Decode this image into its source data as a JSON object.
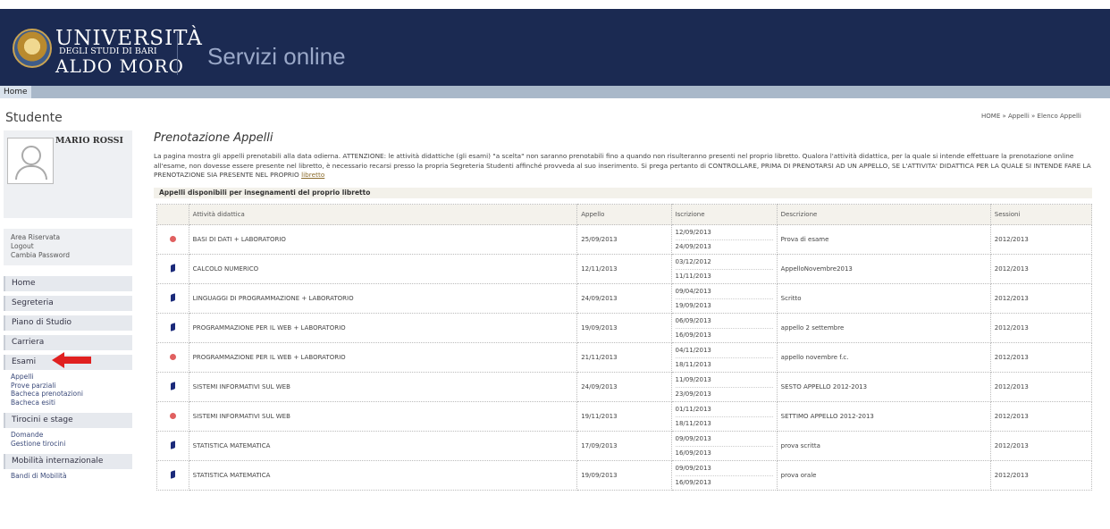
{
  "header": {
    "uni_line1": "UNIVERSITÀ",
    "uni_line2": "DEGLI STUDI DI BARI",
    "uni_line3": "ALDO MORO",
    "service_title": "Servizi online"
  },
  "menubar": {
    "home": "Home"
  },
  "sidebar": {
    "title": "Studente",
    "profile_name": "MARIO ROSSI",
    "area_links": [
      "Area Riservata",
      "Logout",
      "Cambia Password"
    ],
    "nav": [
      {
        "label": "Home",
        "sub": []
      },
      {
        "label": "Segreteria",
        "sub": []
      },
      {
        "label": "Piano di Studio",
        "sub": []
      },
      {
        "label": "Carriera",
        "sub": []
      },
      {
        "label": "Esami",
        "sub": [
          "Appelli",
          "Prove parziali",
          "Bacheca prenotazioni",
          "Bacheca esiti"
        ]
      },
      {
        "label": "Tirocini e stage",
        "sub": [
          "Domande",
          "Gestione tirocini"
        ]
      },
      {
        "label": "Mobilità internazionale",
        "sub": [
          "Bandi di Mobilità"
        ]
      }
    ]
  },
  "breadcrumb": "HOME » Appelli » Elenco Appelli",
  "main": {
    "title": "Prenotazione Appelli",
    "intro_text": "La pagina mostra gli appelli prenotabili alla data odierna. ATTENZIONE: le attività didattiche (gli esami) \"a scelta\" non saranno prenotabili fino a quando non risulteranno presenti nel proprio libretto. Qualora l'attività didattica, per la quale si intende effettuare la prenotazione online all'esame, non dovesse essere presente nel libretto, è necessario recarsi presso la propria Segreteria Studenti affinché provveda al suo inserimento. Si prega pertanto di CONTROLLARE, PRIMA DI PRENOTARSI AD UN APPELLO, SE L'ATTIVITA' DIDATTICA PER LA QUALE SI INTENDE FARE LA PRENOTAZIONE SIA PRESENTE NEL PROPRIO",
    "intro_link": "libretto",
    "table_caption": "Appelli disponibili per insegnamenti del proprio libretto",
    "columns": [
      "",
      "Attività didattica",
      "Appello",
      "Iscrizione",
      "Descrizione",
      "Sessioni"
    ],
    "rows": [
      {
        "status": "closed",
        "activity": "BASI DI DATI + LABORATORIO",
        "appello": "25/09/2013",
        "iscr_from": "12/09/2013",
        "iscr_to": "24/09/2013",
        "descr": "Prova di esame",
        "sessione": "2012/2013"
      },
      {
        "status": "open",
        "activity": "CALCOLO NUMERICO",
        "appello": "12/11/2013",
        "iscr_from": "03/12/2012",
        "iscr_to": "11/11/2013",
        "descr": "AppelloNovembre2013",
        "sessione": "2012/2013"
      },
      {
        "status": "open",
        "activity": "LINGUAGGI DI PROGRAMMAZIONE + LABORATORIO",
        "appello": "24/09/2013",
        "iscr_from": "09/04/2013",
        "iscr_to": "19/09/2013",
        "descr": "Scritto",
        "sessione": "2012/2013"
      },
      {
        "status": "open",
        "activity": "PROGRAMMAZIONE PER IL WEB + LABORATORIO",
        "appello": "19/09/2013",
        "iscr_from": "06/09/2013",
        "iscr_to": "16/09/2013",
        "descr": "appello 2 settembre",
        "sessione": "2012/2013"
      },
      {
        "status": "closed",
        "activity": "PROGRAMMAZIONE PER IL WEB + LABORATORIO",
        "appello": "21/11/2013",
        "iscr_from": "04/11/2013",
        "iscr_to": "18/11/2013",
        "descr": "appello novembre f.c.",
        "sessione": "2012/2013"
      },
      {
        "status": "open",
        "activity": "SISTEMI INFORMATIVI SUL WEB",
        "appello": "24/09/2013",
        "iscr_from": "11/09/2013",
        "iscr_to": "23/09/2013",
        "descr": "SESTO APPELLO 2012-2013",
        "sessione": "2012/2013"
      },
      {
        "status": "closed",
        "activity": "SISTEMI INFORMATIVI SUL WEB",
        "appello": "19/11/2013",
        "iscr_from": "01/11/2013",
        "iscr_to": "18/11/2013",
        "descr": "SETTIMO APPELLO 2012-2013",
        "sessione": "2012/2013"
      },
      {
        "status": "open",
        "activity": "STATISTICA MATEMATICA",
        "appello": "17/09/2013",
        "iscr_from": "09/09/2013",
        "iscr_to": "16/09/2013",
        "descr": "prova scritta",
        "sessione": "2012/2013"
      },
      {
        "status": "open",
        "activity": "STATISTICA MATEMATICA",
        "appello": "19/09/2013",
        "iscr_from": "09/09/2013",
        "iscr_to": "16/09/2013",
        "descr": "prova orale",
        "sessione": "2012/2013"
      }
    ]
  },
  "colors": {
    "header_bg": "#1b2a52",
    "menubar_bg": "#a9b8c9",
    "closed_icon": "#e06060",
    "open_icon": "#1b2a7a",
    "arrow": "#e02020"
  },
  "icons": {
    "closed": "red-dot-icon",
    "open": "book-icon",
    "annotation": "red-arrow-icon"
  }
}
